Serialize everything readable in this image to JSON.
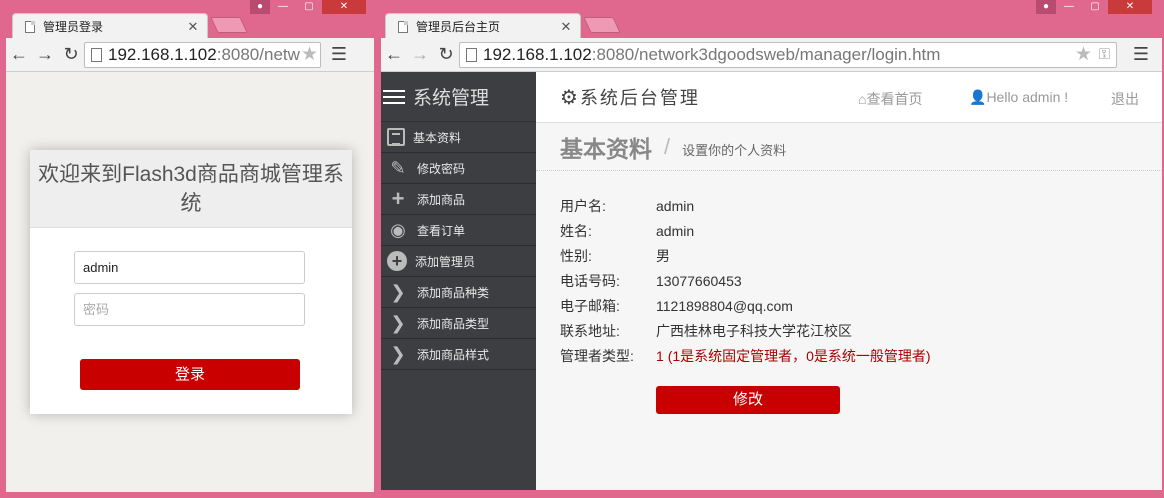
{
  "left_window": {
    "tab_title": "管理员登录",
    "url_host": "192.168.1.102",
    "url_rest": ":8080/netw",
    "login": {
      "heading": "欢迎来到Flash3d商品商城管理系统",
      "username_value": "admin",
      "password_placeholder": "密码",
      "submit_label": "登录"
    }
  },
  "right_window": {
    "tab_title": "管理员后台主页",
    "url_host": "192.168.1.102",
    "url_rest": ":8080/network3dgoodsweb/manager/login.htm",
    "sidebar": {
      "title": "系统管理",
      "items": [
        {
          "label": "基本资料",
          "icon": "list-icon"
        },
        {
          "label": "修改密码",
          "icon": "pencil-icon"
        },
        {
          "label": "添加商品",
          "icon": "plus-icon"
        },
        {
          "label": "查看订单",
          "icon": "eye-icon"
        },
        {
          "label": "添加管理员",
          "icon": "plus-circle-icon"
        },
        {
          "label": "添加商品种类",
          "icon": "chevron-right-icon"
        },
        {
          "label": "添加商品类型",
          "icon": "chevron-right-icon"
        },
        {
          "label": "添加商品样式",
          "icon": "chevron-right-icon"
        }
      ]
    },
    "topbar": {
      "brand": "系统后台管理",
      "home_link": "查看首页",
      "greeting": "Hello admin !",
      "logout": "退出"
    },
    "page": {
      "title": "基本资料",
      "separator": "/",
      "subtitle": "设置你的个人资料",
      "fields": [
        {
          "label": "用户名:",
          "value": "admin"
        },
        {
          "label": "姓名:",
          "value": "admin"
        },
        {
          "label": "性别:",
          "value": "男"
        },
        {
          "label": "电话号码:",
          "value": "13077660453"
        },
        {
          "label": "电子邮箱:",
          "value": "1121898804@qq.com"
        },
        {
          "label": "联系地址:",
          "value": "广西桂林电子科技大学花江校区"
        },
        {
          "label": "管理者类型:",
          "value": "1",
          "note": "(1是系统固定管理者，0是系统一般管理者)"
        }
      ],
      "edit_label": "修改"
    }
  },
  "colors": {
    "frame": "#e0688e",
    "accent_red": "#c80000",
    "sidebar_bg": "#3d3e42"
  }
}
